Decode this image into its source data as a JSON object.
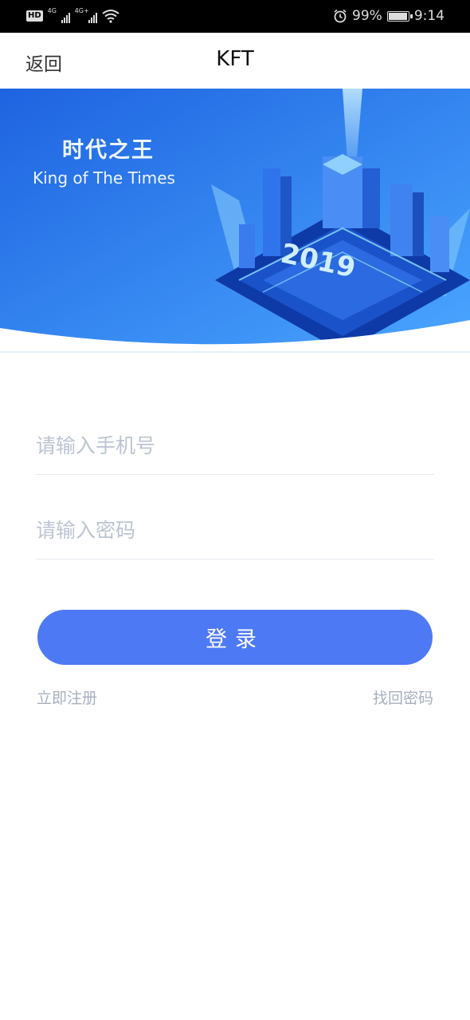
{
  "status_bar": {
    "network_left": "4G",
    "network_right": "4G+",
    "battery": "99%",
    "time": "9:14"
  },
  "header": {
    "back_label": "返回",
    "title": "KFT"
  },
  "banner": {
    "title_cn": "时代之王",
    "title_en": "King of  The Times",
    "year": "2019",
    "colors": {
      "bg_top": "#1e63e0",
      "bg_bottom": "#4aa6ff"
    }
  },
  "form": {
    "phone_placeholder": "请输入手机号",
    "phone_value": "",
    "password_placeholder": "请输入密码",
    "password_value": ""
  },
  "actions": {
    "login_label": "登录",
    "register_label": "立即注册",
    "forgot_label": "找回密码",
    "accent": "#4e79f5"
  }
}
